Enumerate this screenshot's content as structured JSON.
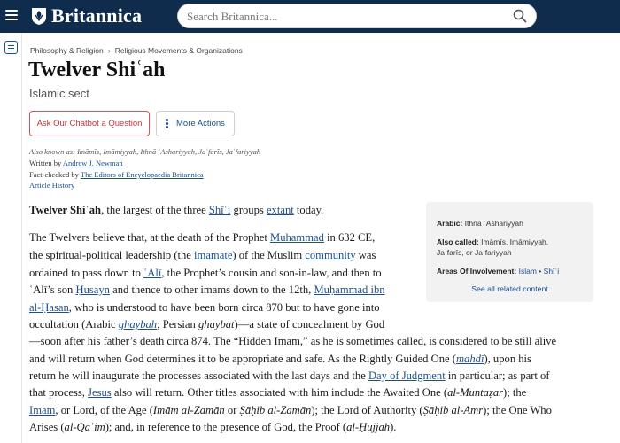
{
  "header": {
    "logo_text": "Britannica",
    "search_placeholder": "Search Britannica..."
  },
  "breadcrumb": [
    "Philosophy & Religion",
    "Religious Movements & Organizations"
  ],
  "breadcrumb_separator": "›",
  "title": "Twelver Shiʿah",
  "subtitle": "Islamic sect",
  "buttons": {
    "chatbot": "Ask Our Chatbot a Question",
    "more_actions": "More Actions"
  },
  "meta": {
    "also_known_as": "Also known as: Imāmīs, Imāmiyyah, Ithnā ʿAshariyyah, Jaʿfarīs, Jaʿfariyyah",
    "written_by_label": "Written by",
    "written_by": "Andrew J. Newman",
    "fact_checked_label": "Fact-checked by",
    "fact_checked_by": "The Editors of Encyclopaedia Britannica",
    "article_history": "Article History"
  },
  "infobox": {
    "arabic_label": "Arabic:",
    "arabic_value": "Ithnā ʿAshariyyah",
    "also_called_label": "Also called:",
    "also_called_line1": "Imāmīs, Imāmiyyah,",
    "also_called_line2": "Jaʿfarīs, or Jaʿfariyyah",
    "areas_label": "Areas Of Involvement:",
    "areas": [
      "Islam",
      "Shīʿi"
    ],
    "areas_sep": "•",
    "see_all": "See all related content"
  },
  "article": {
    "p1": {
      "term": "Twelver Shiʿah",
      "t1": ", the largest of the three ",
      "l1": "Shīʿi",
      "t2": " groups ",
      "l2": "extant",
      "t3": " today."
    },
    "p2": {
      "l1a": "The Twelvers believe that, at the death of the Prophet ",
      "l1link": "Muhammad",
      "l1b": " in 632 CE,",
      "l2a": "the spiritual-political leadership (the ",
      "l2link": "imamate",
      "l2b": ") of the Muslim ",
      "l2link2": "community",
      "l2c": " was",
      "l3a": "ordained to pass down to ",
      "l3link": "ʿAlī",
      "l3b": ", the Prophet’s cousin and son-in-law, and then to",
      "l4a": "ʿAlī’s son ",
      "l4link": "Ḥusayn",
      "l4b": " and thence to other imams down to the 12th, ",
      "l4link2": "Muḥammad ibn",
      "l5link": "al-Ḥasan",
      "l5b": ", who is understood to have been born circa 870 but to have gone into",
      "l6a": "occultation (Arabic ",
      "l6link": "ghaybah",
      "l6b": "; Persian ",
      "l6i": "ghaybat",
      "l6c": ")—a state of concealment by God",
      "l7": "—soon after his father’s death circa 874. The “Hidden Imam,” as he is sometimes called, is considered to be still alive",
      "l8a": "and will return when God determines it to be appropriate and safe. As the Rightly Guided One (",
      "l8link": "mahdī",
      "l8b": "), upon his",
      "l9a": "return he will inaugurate the processes associated with the last days and the ",
      "l9link": "Day of Judgment",
      "l9b": " in particular; as part of",
      "l10a": "that process, ",
      "l10link": "Jesus",
      "l10b": " also will return. Other titles associated with him include the Awaited One (",
      "l10i": "al-Muntaẓar",
      "l10c": "); the",
      "l11link": "Imam",
      "l11a": ", or Lord, of the Age (",
      "l11i1": "Imām al-Zamān",
      "l11b": " or ",
      "l11i2": "Ṣāḥib al-Zamān",
      "l11c": "); the Lord of Authority (",
      "l11i3": "Ṣāḥib al-Amr",
      "l11d": "); the One Who",
      "l12a": "Arises (",
      "l12i1": "al-Qāʾim",
      "l12b": "); and, in reference to the presence of God, the Proof (",
      "l12i2": "al-Ḥujjah",
      "l12c": ")."
    }
  }
}
